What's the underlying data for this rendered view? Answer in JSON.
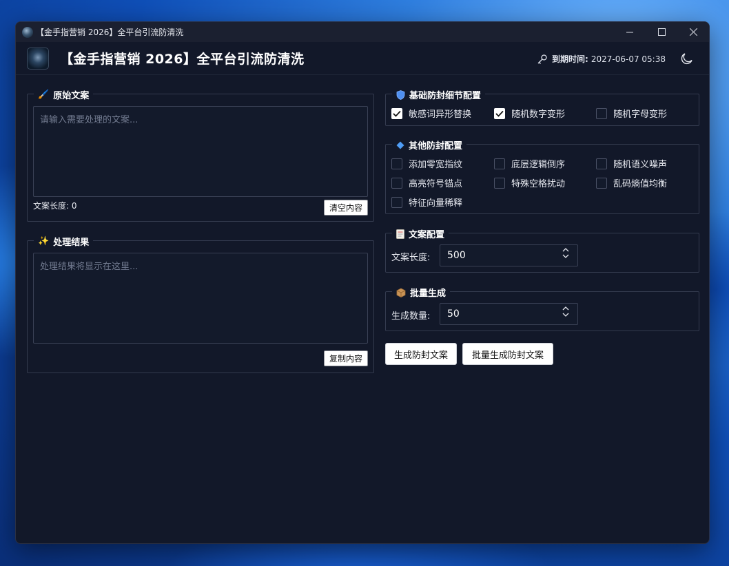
{
  "window": {
    "title": "【金手指营销 2026】全平台引流防清洗"
  },
  "header": {
    "app_title": "【金手指营销 2026】全平台引流防清洗",
    "expiry_label": "到期时间:",
    "expiry_value": "2027-06-07 05:38"
  },
  "source": {
    "legend": "原始文案",
    "placeholder": "请输入需要处理的文案...",
    "length_label": "文案长度: 0",
    "clear_button": "清空内容"
  },
  "result": {
    "legend": "处理结果",
    "placeholder": "处理结果将显示在这里...",
    "copy_button": "复制内容"
  },
  "basic_config": {
    "legend": "基础防封细节配置",
    "options": [
      {
        "label": "敏感词异形替换",
        "checked": true
      },
      {
        "label": "随机数字变形",
        "checked": true
      },
      {
        "label": "随机字母变形",
        "checked": false
      }
    ]
  },
  "other_config": {
    "legend": "其他防封配置",
    "options": [
      {
        "label": "添加零宽指纹",
        "checked": false
      },
      {
        "label": "底层逻辑倒序",
        "checked": false
      },
      {
        "label": "随机语义噪声",
        "checked": false
      },
      {
        "label": "高亮符号锚点",
        "checked": false
      },
      {
        "label": "特殊空格扰动",
        "checked": false
      },
      {
        "label": "乱码熵值均衡",
        "checked": false
      },
      {
        "label": "特征向量稀释",
        "checked": false
      }
    ]
  },
  "copy_config": {
    "legend": "文案配置",
    "length_label": "文案长度:",
    "length_value": "500"
  },
  "batch": {
    "legend": "批量生成",
    "count_label": "生成数量:",
    "count_value": "50"
  },
  "actions": {
    "generate": "生成防封文案",
    "batch_generate": "批量生成防封文案"
  },
  "icons": {
    "source": "brush-icon",
    "result": "sparkles-icon",
    "basic": "shield-icon",
    "other": "diamond-icon",
    "copy": "memo-icon",
    "batch": "package-icon",
    "expiry": "key-icon",
    "theme": "moon-icon"
  }
}
